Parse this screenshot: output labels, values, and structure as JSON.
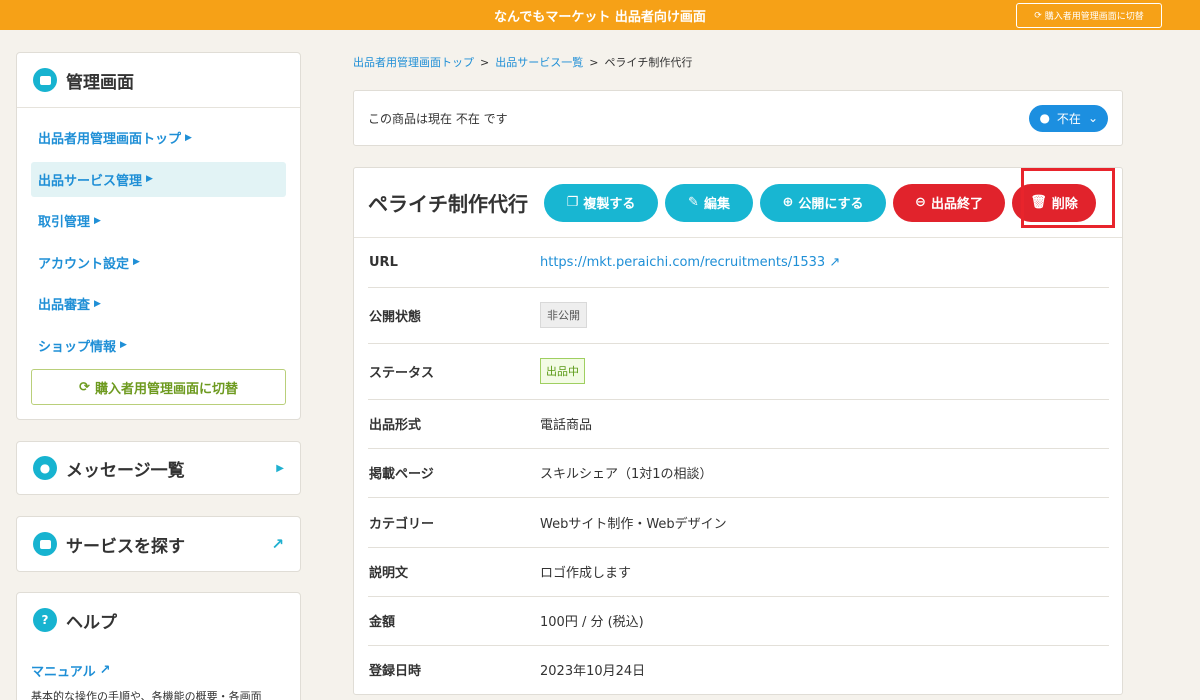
{
  "header": {
    "title": "なんでもマーケット 出品者向け画面",
    "switch_label": "購入者用管理画面に切替"
  },
  "sidebar": {
    "admin_title": "管理画面",
    "items": [
      {
        "label": "出品者用管理画面トップ"
      },
      {
        "label": "出品サービス管理"
      },
      {
        "label": "取引管理"
      },
      {
        "label": "アカウント設定"
      },
      {
        "label": "出品審査"
      },
      {
        "label": "ショップ情報"
      }
    ],
    "switch_label": "購入者用管理画面に切替",
    "messages_label": "メッセージ一覧",
    "find_services_label": "サービスを探す",
    "help_label": "ヘルプ",
    "manual_label": "マニュアル",
    "manual_desc": "基本的な操作の手順や、各機能の概要・各画面"
  },
  "breadcrumb": {
    "items": [
      "出品者用管理画面トップ",
      "出品サービス一覧",
      "ペライチ制作代行"
    ],
    "separator": ">"
  },
  "availability": {
    "message": "この商品は現在 不在 です",
    "status_label": "不在"
  },
  "service": {
    "title": "ペライチ制作代行",
    "buttons": {
      "duplicate": "複製する",
      "edit": "編集",
      "publish": "公開にする",
      "end_listing": "出品終了",
      "delete": "削除"
    },
    "rows": [
      {
        "key": "URL",
        "value": "https://mkt.peraichi.com/recruitments/1533"
      },
      {
        "key": "公開状態",
        "value": "非公開"
      },
      {
        "key": "ステータス",
        "value": "出品中"
      },
      {
        "key": "出品形式",
        "value": "電話商品"
      },
      {
        "key": "掲載ページ",
        "value": "スキルシェア（1対1の相談）"
      },
      {
        "key": "カテゴリー",
        "value": "Webサイト制作・Webデザイン"
      },
      {
        "key": "説明文",
        "value": "ロゴ作成します"
      },
      {
        "key": "金額",
        "value": "100円 / 分 (税込)"
      },
      {
        "key": "登録日時",
        "value": "2023年10月24日"
      }
    ]
  },
  "colors": {
    "header": "#f6a117",
    "link": "#1f8fd6",
    "teal_button": "#18b6d2",
    "red_button": "#e1232c",
    "highlight_box": "#e8242c"
  }
}
